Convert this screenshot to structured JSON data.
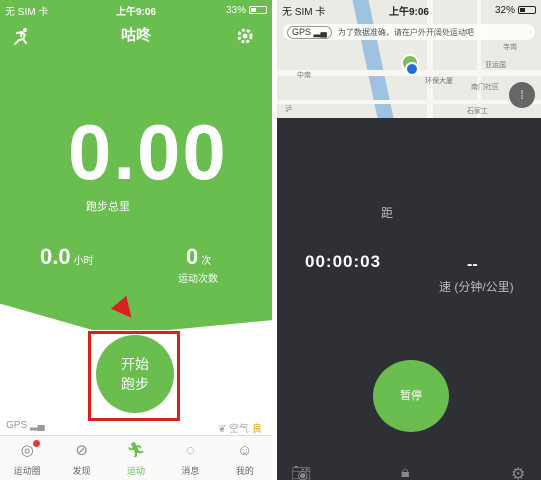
{
  "left": {
    "status": {
      "carrier": "无 SIM 卡",
      "time": "上午9:06",
      "battery": "33%"
    },
    "header": {
      "title": "咕咚",
      "run_icon": "runner-icon",
      "settings_icon": "gear-icon"
    },
    "distance": {
      "value": "0.00",
      "label": "跑步总里"
    },
    "duration": {
      "value": "0.0",
      "unit": "小时"
    },
    "runs": {
      "value": "0",
      "unit": "次",
      "label": "运动次数"
    },
    "start_button": {
      "line1": "开始",
      "line2": "跑步"
    },
    "gps": "GPS",
    "air": {
      "label": "空气",
      "value": "良"
    },
    "tabs": [
      {
        "label": "运动圈",
        "icon": "circle-icon"
      },
      {
        "label": "发现",
        "icon": "compass-icon"
      },
      {
        "label": "运动",
        "icon": "runner-icon"
      },
      {
        "label": "消息",
        "icon": "chat-icon"
      },
      {
        "label": "我的",
        "icon": "person-icon"
      }
    ]
  },
  "right": {
    "status": {
      "carrier": "无 SIM 卡",
      "time": "上午9:06",
      "battery": "32%"
    },
    "gps_bar": {
      "pill": "GPS",
      "text": "为了数据准确，请在户外开阔处运动吧"
    },
    "map_labels": [
      "环保大厦",
      "南门社区",
      "寺岗",
      "亚运国",
      "石家工",
      "中南",
      "泸"
    ],
    "distance_label": "距",
    "timer": "00:00:03",
    "pace": {
      "value": "--",
      "label": "速 (分钟/公里)"
    },
    "pause_button": "暂停",
    "icons": [
      "camera-icon",
      "lock-icon",
      "gear-icon"
    ]
  },
  "colors": {
    "accent": "#6abd4f",
    "dark_bg": "#2f3036",
    "highlight": "#d8201e"
  }
}
